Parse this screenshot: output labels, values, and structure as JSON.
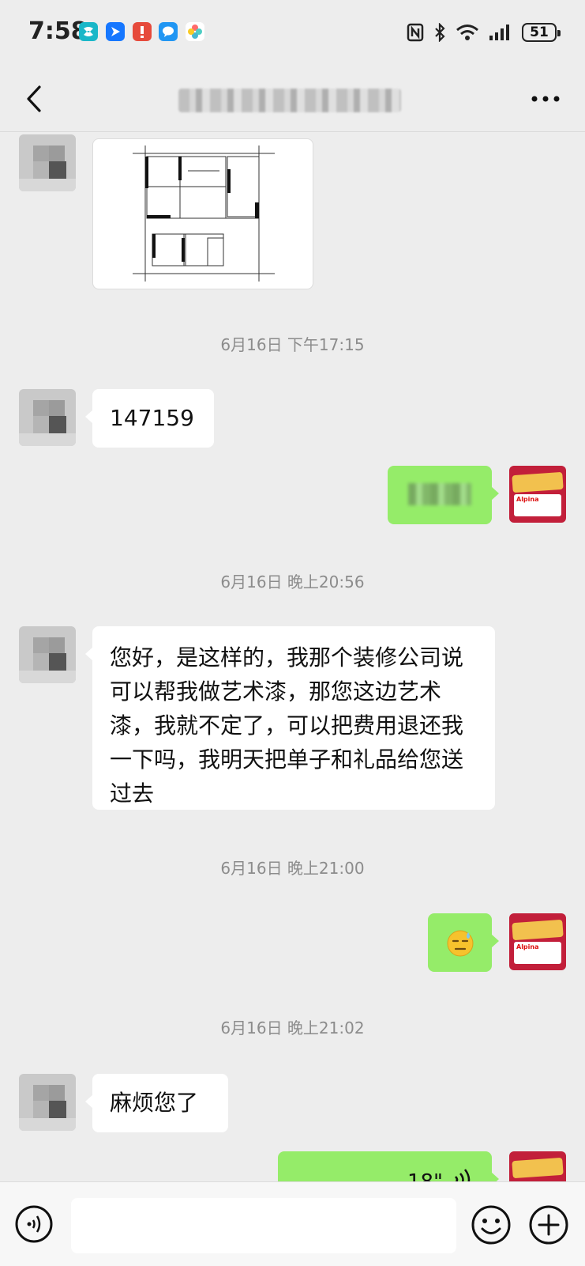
{
  "status_bar": {
    "time": "7:58",
    "battery": "51"
  },
  "header": {
    "back_icon": "chevron-left-icon",
    "title": "",
    "more_icon": "more-dots-icon"
  },
  "messages": {
    "ts1": "6月16日 下午17:15",
    "msg1": "147159",
    "ts2": "6月16日 晚上20:56",
    "msg3": "您好，是这样的，我那个装修公司说可以帮我做艺术漆，那您这边艺术漆，我就不定了，可以把费用退还我一下吗，我明天把单子和礼品给您送过去",
    "ts3": "6月16日 晚上21:00",
    "ts4": "6月16日 晚上21:02",
    "msg5": "麻烦您了",
    "voice_duration": "18\""
  },
  "avatar_right": {
    "caption": "Alpina"
  },
  "input_bar": {
    "placeholder": ""
  },
  "colors": {
    "bubble_self": "#95ec69",
    "bubble_other": "#ffffff",
    "background": "#ededed"
  }
}
